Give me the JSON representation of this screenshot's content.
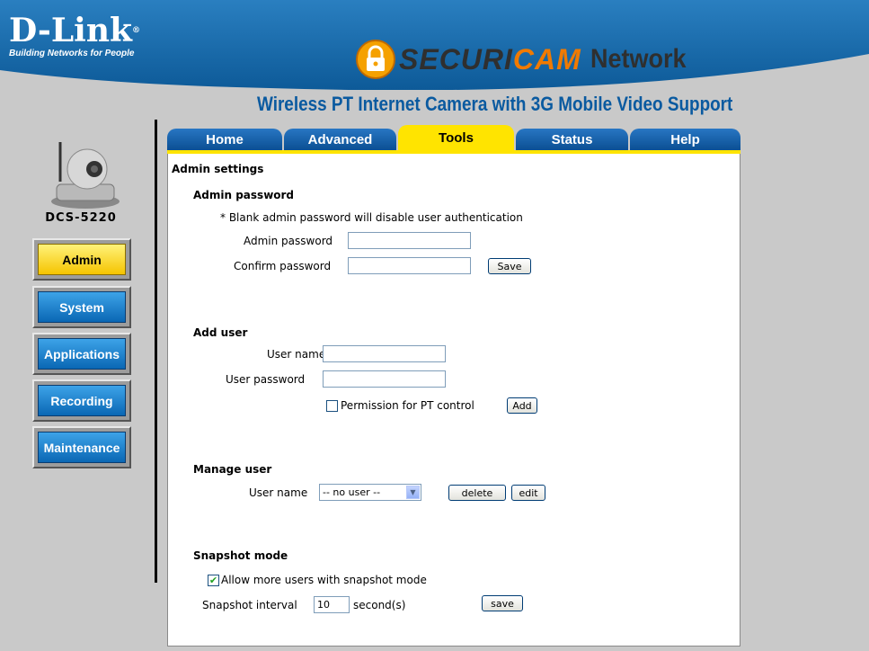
{
  "header": {
    "logo_main": "D-Link",
    "logo_reg": "®",
    "logo_tagline": "Building Networks for People",
    "brand_securi": "SECURI",
    "brand_cam": "CAM",
    "brand_network": "Network",
    "subtitle": "Wireless PT Internet Camera with 3G Mobile Video Support"
  },
  "sidebar": {
    "model": "DCS-5220",
    "items": [
      {
        "label": "Admin",
        "active": true
      },
      {
        "label": "System"
      },
      {
        "label": "Applications"
      },
      {
        "label": "Recording"
      },
      {
        "label": "Maintenance"
      }
    ]
  },
  "tabs": [
    {
      "label": "Home"
    },
    {
      "label": "Advanced"
    },
    {
      "label": "Tools",
      "active": true
    },
    {
      "label": "Status"
    },
    {
      "label": "Help"
    }
  ],
  "main": {
    "section_title": "Admin settings",
    "admin_password": {
      "heading": "Admin password",
      "note": "* Blank admin password will disable user authentication",
      "password_label": "Admin password",
      "password_value": "",
      "confirm_label": "Confirm password",
      "confirm_value": "",
      "save_label": "Save"
    },
    "add_user": {
      "heading": "Add user",
      "username_label": "User name",
      "username_value": "",
      "password_label": "User password",
      "password_value": "",
      "permission_label": "Permission for PT control",
      "permission_checked": false,
      "add_label": "Add"
    },
    "manage_user": {
      "heading": "Manage user",
      "username_label": "User name",
      "selected": "-- no user --",
      "delete_label": "delete",
      "edit_label": "edit"
    },
    "snapshot": {
      "heading": "Snapshot mode",
      "allow_label": "Allow more users with snapshot mode",
      "allow_checked": true,
      "interval_label": "Snapshot interval",
      "interval_value": "10",
      "interval_unit": "second(s)",
      "save_label": "save"
    }
  },
  "colors": {
    "header_blue": "#1565a8",
    "tab_active": "#ffe400",
    "subtitle": "#0a5aa0",
    "brand_orange": "#f07a00"
  },
  "icons": [
    "lock-icon",
    "camera-image",
    "checkbox-check-icon",
    "dropdown-arrow-icon"
  ]
}
